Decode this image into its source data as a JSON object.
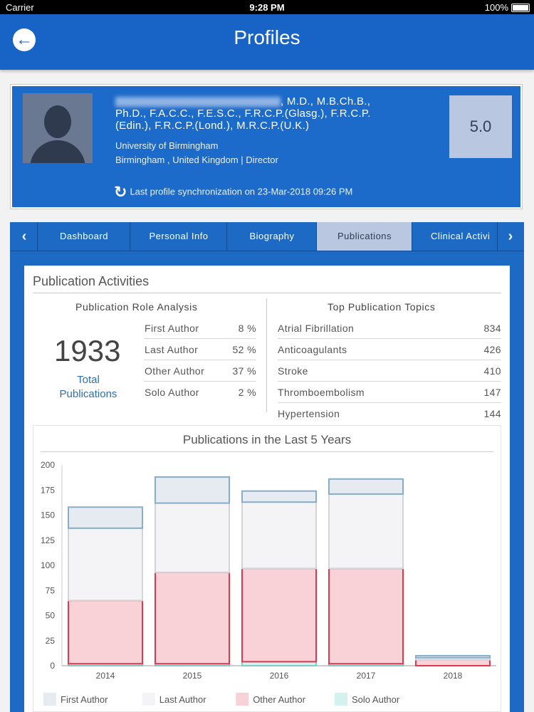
{
  "status_bar": {
    "carrier": "Carrier",
    "time": "9:28 PM",
    "battery": "100%"
  },
  "header": {
    "title": "Profiles"
  },
  "profile": {
    "name_rest_line1": ", M.D., M.B.Ch.B.,",
    "name_line2": "Ph.D., F.A.C.C., F.E.S.C., F.R.C.P.(Glasg.), F.R.C.P.",
    "name_line3": "(Edin.), F.R.C.P.(Lond.), M.R.C.P.(U.K.)",
    "institution": "University of Birmingham",
    "location": "Birmingham , United Kingdom | Director",
    "sync_text": "Last profile synchronization on 23-Mar-2018 09:26 PM",
    "score": "5.0"
  },
  "tabs": [
    {
      "label": "Dashboard"
    },
    {
      "label": "Personal Info"
    },
    {
      "label": "Biography"
    },
    {
      "label": "Publications"
    },
    {
      "label": "Clinical Activi"
    }
  ],
  "activities": {
    "title": "Publication Activities",
    "role_title": "Publication Role Analysis",
    "total": "1933",
    "total_label_1": "Total",
    "total_label_2": "Publications",
    "roles": [
      {
        "label": "First Author",
        "value": "8 %"
      },
      {
        "label": "Last Author",
        "value": "52 %"
      },
      {
        "label": "Other Author",
        "value": "37 %"
      },
      {
        "label": "Solo Author",
        "value": "2 %"
      }
    ],
    "topics_title": "Top Publication Topics",
    "topics": [
      {
        "label": "Atrial Fibrillation",
        "value": "834"
      },
      {
        "label": "Anticoagulants",
        "value": "426"
      },
      {
        "label": "Stroke",
        "value": "410"
      },
      {
        "label": "Thromboembolism",
        "value": "147"
      },
      {
        "label": "Hypertension",
        "value": "144"
      }
    ]
  },
  "chart_data": {
    "type": "bar",
    "stacked": true,
    "title": "Publications in the Last 5 Years",
    "categories": [
      "2014",
      "2015",
      "2016",
      "2017",
      "2018"
    ],
    "ylim": [
      0,
      200
    ],
    "yticks": [
      0,
      25,
      50,
      75,
      100,
      125,
      150,
      175,
      200
    ],
    "legend_position": "bottom",
    "series": [
      {
        "name": "Solo Author",
        "values": [
          2,
          2,
          4,
          2,
          0
        ],
        "fill": "#d3f1ef",
        "stroke": "#7ccbc6"
      },
      {
        "name": "Other Author",
        "values": [
          63,
          91,
          93,
          95,
          6
        ],
        "fill": "#f8d2d7",
        "stroke": "#e3374f"
      },
      {
        "name": "Last Author",
        "values": [
          72,
          69,
          66,
          74,
          2
        ],
        "fill": "#f4f4f6",
        "stroke": "#d4d4d8"
      },
      {
        "name": "First Author",
        "values": [
          21,
          26,
          11,
          15,
          2
        ],
        "fill": "#e6ebf1",
        "stroke": "#86aecb"
      }
    ],
    "legend_order": [
      "First Author",
      "Last Author",
      "Other Author",
      "Solo Author"
    ]
  }
}
